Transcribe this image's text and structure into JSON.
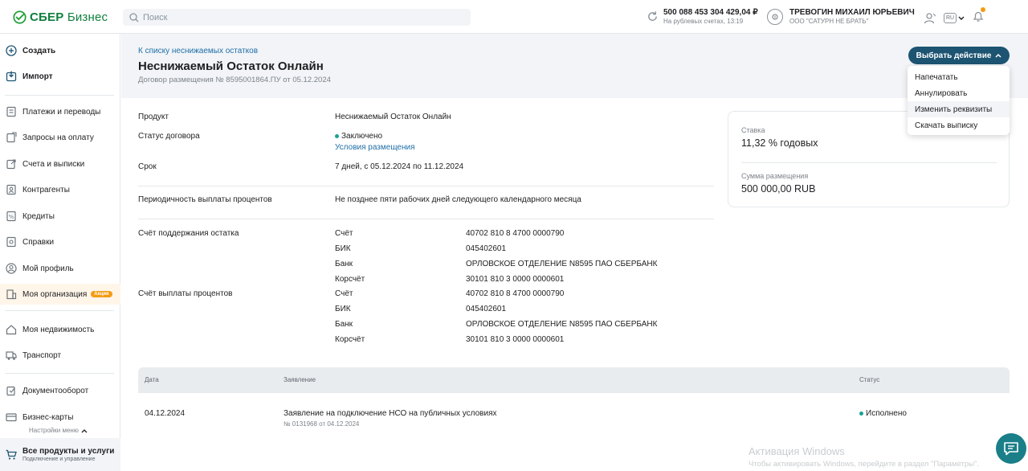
{
  "topbar": {
    "logo_text_bold": "СБЕР",
    "logo_text": "Бизнес",
    "search_placeholder": "Поиск",
    "balance_amount": "500 088 453 304 429,04 ₽",
    "balance_sub": "На рублевых счетах, 13:19",
    "user_name": "ТРЕВОГИН МИХАИЛ ЮРЬЕВИЧ",
    "user_org": "ООО \"САТУРН НЕ БРАТЬ\"",
    "lang": "RU"
  },
  "sidebar": {
    "create": "Создать",
    "import": "Импорт",
    "items": [
      {
        "label": "Платежи и переводы",
        "icon": "payments-icon"
      },
      {
        "label": "Запросы на оплату",
        "icon": "payment-requests-icon"
      },
      {
        "label": "Счета и выписки",
        "icon": "accounts-icon"
      },
      {
        "label": "Контрагенты",
        "icon": "contractors-icon"
      },
      {
        "label": "Кредиты",
        "icon": "credits-icon"
      },
      {
        "label": "Справки",
        "icon": "certificates-icon"
      },
      {
        "label": "Мой профиль",
        "icon": "profile-icon"
      },
      {
        "label": "Моя организация",
        "icon": "organization-icon",
        "badge": "Акция"
      },
      {
        "label": "Моя недвижимость",
        "icon": "real-estate-icon"
      },
      {
        "label": "Транспорт",
        "icon": "transport-icon"
      },
      {
        "label": "Документооборот",
        "icon": "documents-icon"
      },
      {
        "label": "Бизнес-карты",
        "icon": "business-cards-icon"
      }
    ],
    "settings": "Настройки меню",
    "bottom_title": "Все продукты и услуги",
    "bottom_sub": "Подключение и управление"
  },
  "header": {
    "back_link": "К списку неснижаемых остатков",
    "title": "Неснижаемый Остаток Онлайн",
    "subtitle": "Договор размещения № 8595001864.ПУ от 05.12.2024",
    "action_button": "Выбрать действие"
  },
  "dropdown": {
    "items": [
      "Напечатать",
      "Аннулировать",
      "Изменить реквизиты",
      "Скачать выписку"
    ]
  },
  "details": {
    "product_label": "Продукт",
    "product_value": "Неснижаемый Остаток Онлайн",
    "status_label": "Статус договора",
    "status_value": "Заключено",
    "status_link": "Условия размещения",
    "term_label": "Срок",
    "term_value": "7 дней, с 05.12.2024 по 11.12.2024",
    "periodicity_label": "Периодичность выплаты процентов",
    "periodicity_value": "Не позднее пяти рабочих дней следующего календарного месяца",
    "support_account_label": "Счёт поддержания остатка",
    "payout_account_label": "Счёт выплаты процентов",
    "support_account": [
      {
        "k": "Счёт",
        "v": "40702 810 8 4700 0000790"
      },
      {
        "k": "БИК",
        "v": "045402601"
      },
      {
        "k": "Банк",
        "v": "ОРЛОВСКОЕ ОТДЕЛЕНИЕ N8595 ПАО СБЕРБАНК"
      },
      {
        "k": "Корсчёт",
        "v": "30101 810 3 0000 0000601"
      }
    ],
    "payout_account": [
      {
        "k": "Счёт",
        "v": "40702 810 8 4700 0000790"
      },
      {
        "k": "БИК",
        "v": "045402601"
      },
      {
        "k": "Банк",
        "v": "ОРЛОВСКОЕ ОТДЕЛЕНИЕ N8595 ПАО СБЕРБАНК"
      },
      {
        "k": "Корсчёт",
        "v": "30101 810 3 0000 0000601"
      }
    ]
  },
  "card": {
    "rate_label": "Ставка",
    "rate_value": "11,32 % годовых",
    "amount_label": "Сумма размещения",
    "amount_value": "500 000,00 RUB"
  },
  "table": {
    "headers": [
      "Дата",
      "Заявление",
      "Статус"
    ],
    "rows": [
      {
        "date": "04.12.2024",
        "statement": "Заявление на подключение НСО на публичных условиях",
        "sub": "№ 0131968 от 04.12.2024",
        "status": "Исполнено"
      }
    ]
  },
  "watermark": {
    "title": "Активация Windows",
    "sub": "Чтобы активировать Windows, перейдите в раздел \"Параметры\"."
  },
  "colors": {
    "brand": "#107f3e",
    "accent": "#1d5472",
    "link": "#1f6fa8",
    "badge": "#f39c12",
    "status": "#1aa195"
  }
}
